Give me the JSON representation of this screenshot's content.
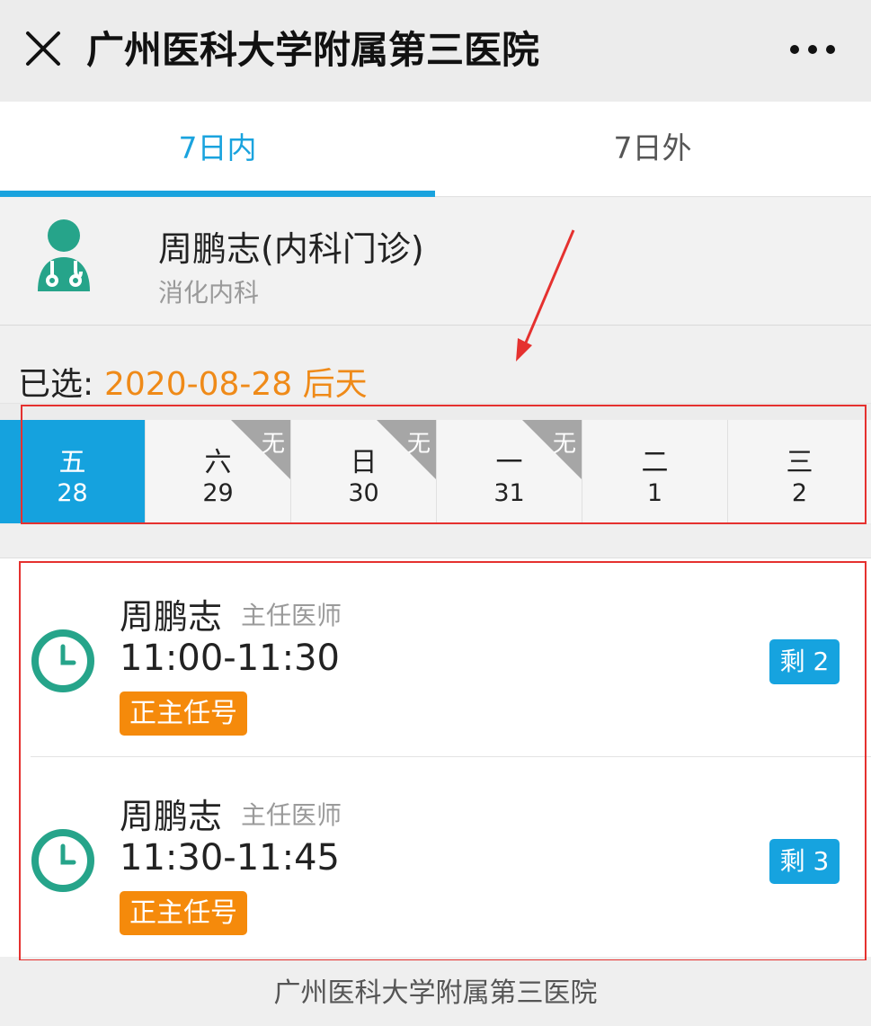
{
  "titlebar": {
    "title": "广州医科大学附属第三医院",
    "close_icon": "close-icon",
    "more_icon": "more-icon"
  },
  "tabs": [
    {
      "label": "7日内",
      "active": true
    },
    {
      "label": "7日外",
      "active": false
    }
  ],
  "doctor": {
    "icon": "doctor-icon",
    "name": "周鹏志(内科门诊)",
    "department": "消化内科"
  },
  "selected": {
    "label": "已选:",
    "value": "2020-08-28 后天"
  },
  "days": [
    {
      "weekday": "五",
      "date": "28",
      "active": true,
      "unavailable": false,
      "badge": ""
    },
    {
      "weekday": "六",
      "date": "29",
      "active": false,
      "unavailable": true,
      "badge": "无"
    },
    {
      "weekday": "日",
      "date": "30",
      "active": false,
      "unavailable": true,
      "badge": "无"
    },
    {
      "weekday": "一",
      "date": "31",
      "active": false,
      "unavailable": true,
      "badge": "无"
    },
    {
      "weekday": "二",
      "date": "1",
      "active": false,
      "unavailable": false,
      "badge": ""
    },
    {
      "weekday": "三",
      "date": "2",
      "active": false,
      "unavailable": false,
      "badge": ""
    }
  ],
  "slots": [
    {
      "doctor": "周鹏志",
      "title": "主任医师",
      "time": "11:00-11:30",
      "tag": "正主任号",
      "remaining": "剩 2",
      "icon": "clock-icon"
    },
    {
      "doctor": "周鹏志",
      "title": "主任医师",
      "time": "11:30-11:45",
      "tag": "正主任号",
      "remaining": "剩 3",
      "icon": "clock-icon"
    }
  ],
  "footer": {
    "text": "广州医科大学附属第三医院"
  },
  "colors": {
    "accent": "#1aa3de",
    "selected_date": "#ef8a18",
    "tag": "#f58a0b",
    "annotation": "#e5312f",
    "icon_green": "#26a48a"
  }
}
